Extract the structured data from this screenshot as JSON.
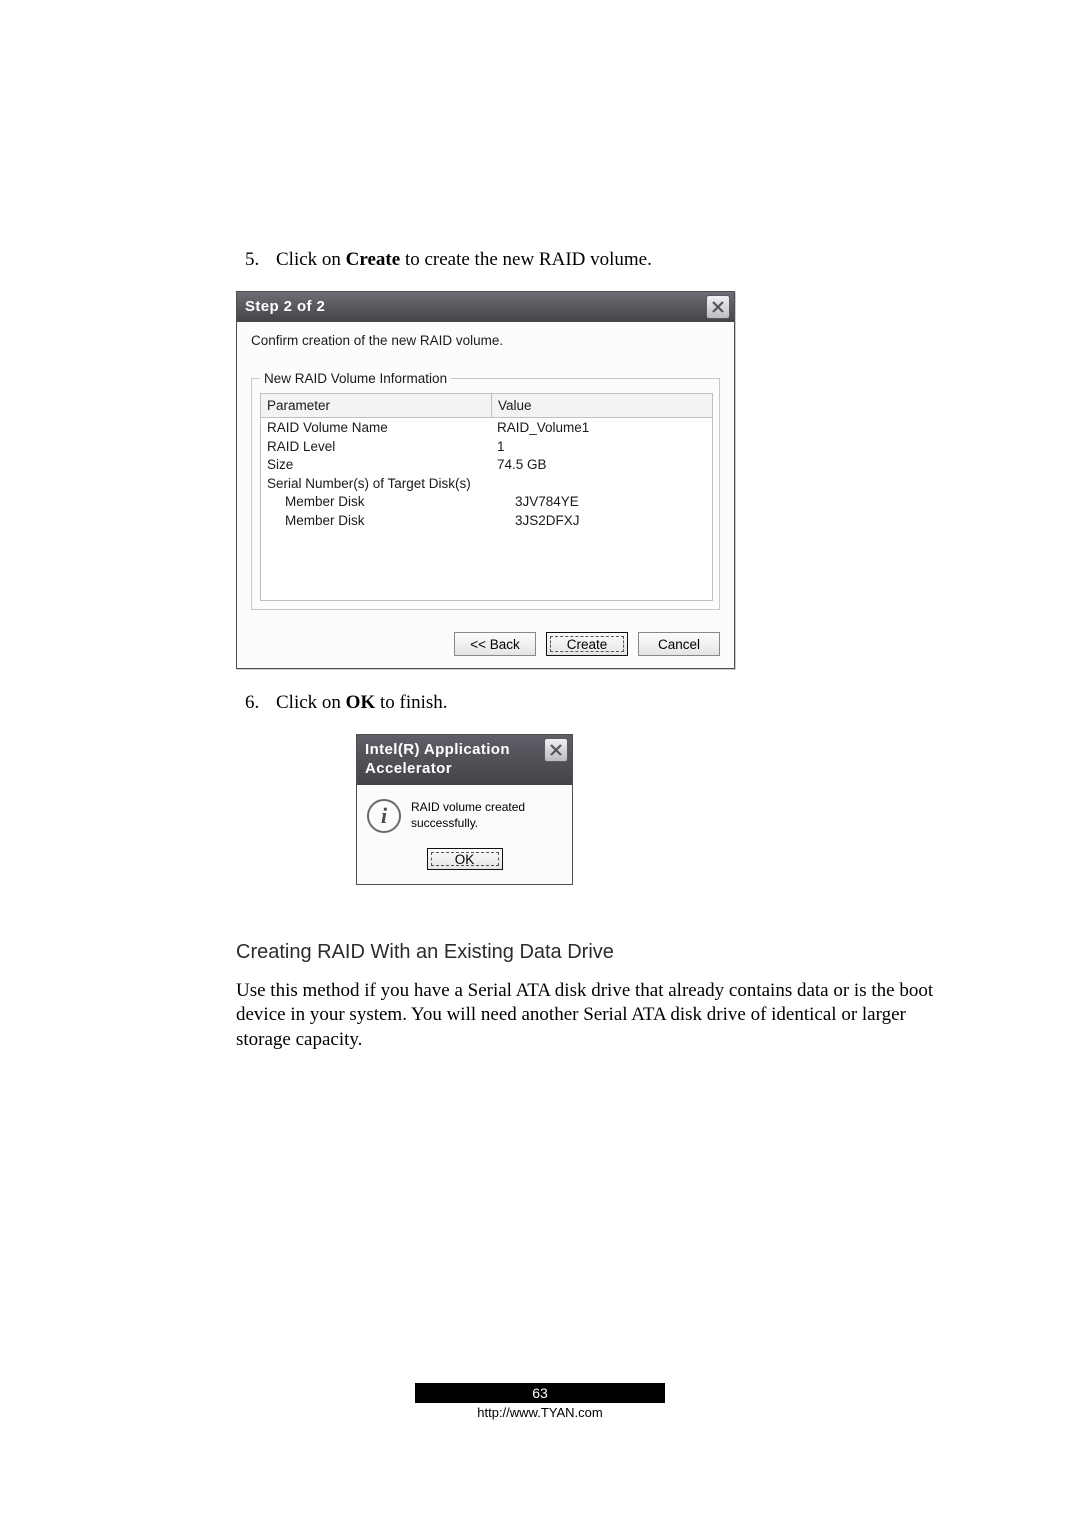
{
  "instructions": {
    "step5": {
      "number": "5.",
      "pre": "Click on ",
      "bold": "Create",
      "post": " to create the new RAID volume."
    },
    "step6": {
      "number": "6.",
      "pre": "Click on ",
      "bold": "OK",
      "post": " to finish."
    }
  },
  "dialog1": {
    "title": "Step 2 of 2",
    "subtitle": "Confirm creation of the new RAID volume.",
    "legend": "New RAID Volume Information",
    "columns": {
      "param": "Parameter",
      "value": "Value"
    },
    "rows": [
      {
        "param": "RAID Volume Name",
        "value": "RAID_Volume1",
        "indent": 0
      },
      {
        "param": "RAID Level",
        "value": "1",
        "indent": 0
      },
      {
        "param": "Size",
        "value": "74.5 GB",
        "indent": 0
      },
      {
        "param": "Serial Number(s) of Target Disk(s)",
        "value": "",
        "indent": 0
      },
      {
        "param": "Member Disk",
        "value": "3JV784YE",
        "indent": 1
      },
      {
        "param": "Member Disk",
        "value": "3JS2DFXJ",
        "indent": 1
      }
    ],
    "buttons": {
      "back": "<< Back",
      "create": "Create",
      "cancel": "Cancel"
    }
  },
  "dialog2": {
    "title": "Intel(R) Application Accelerator",
    "message": "RAID volume created successfully.",
    "ok": "OK"
  },
  "heading": "Creating RAID With an Existing Data Drive",
  "paragraph": "Use this method if you have a Serial ATA disk drive that already contains data or is the boot device in your system. You will need another Serial ATA disk drive of identical or larger storage capacity.",
  "page_number": "63",
  "url": "http://www.TYAN.com"
}
